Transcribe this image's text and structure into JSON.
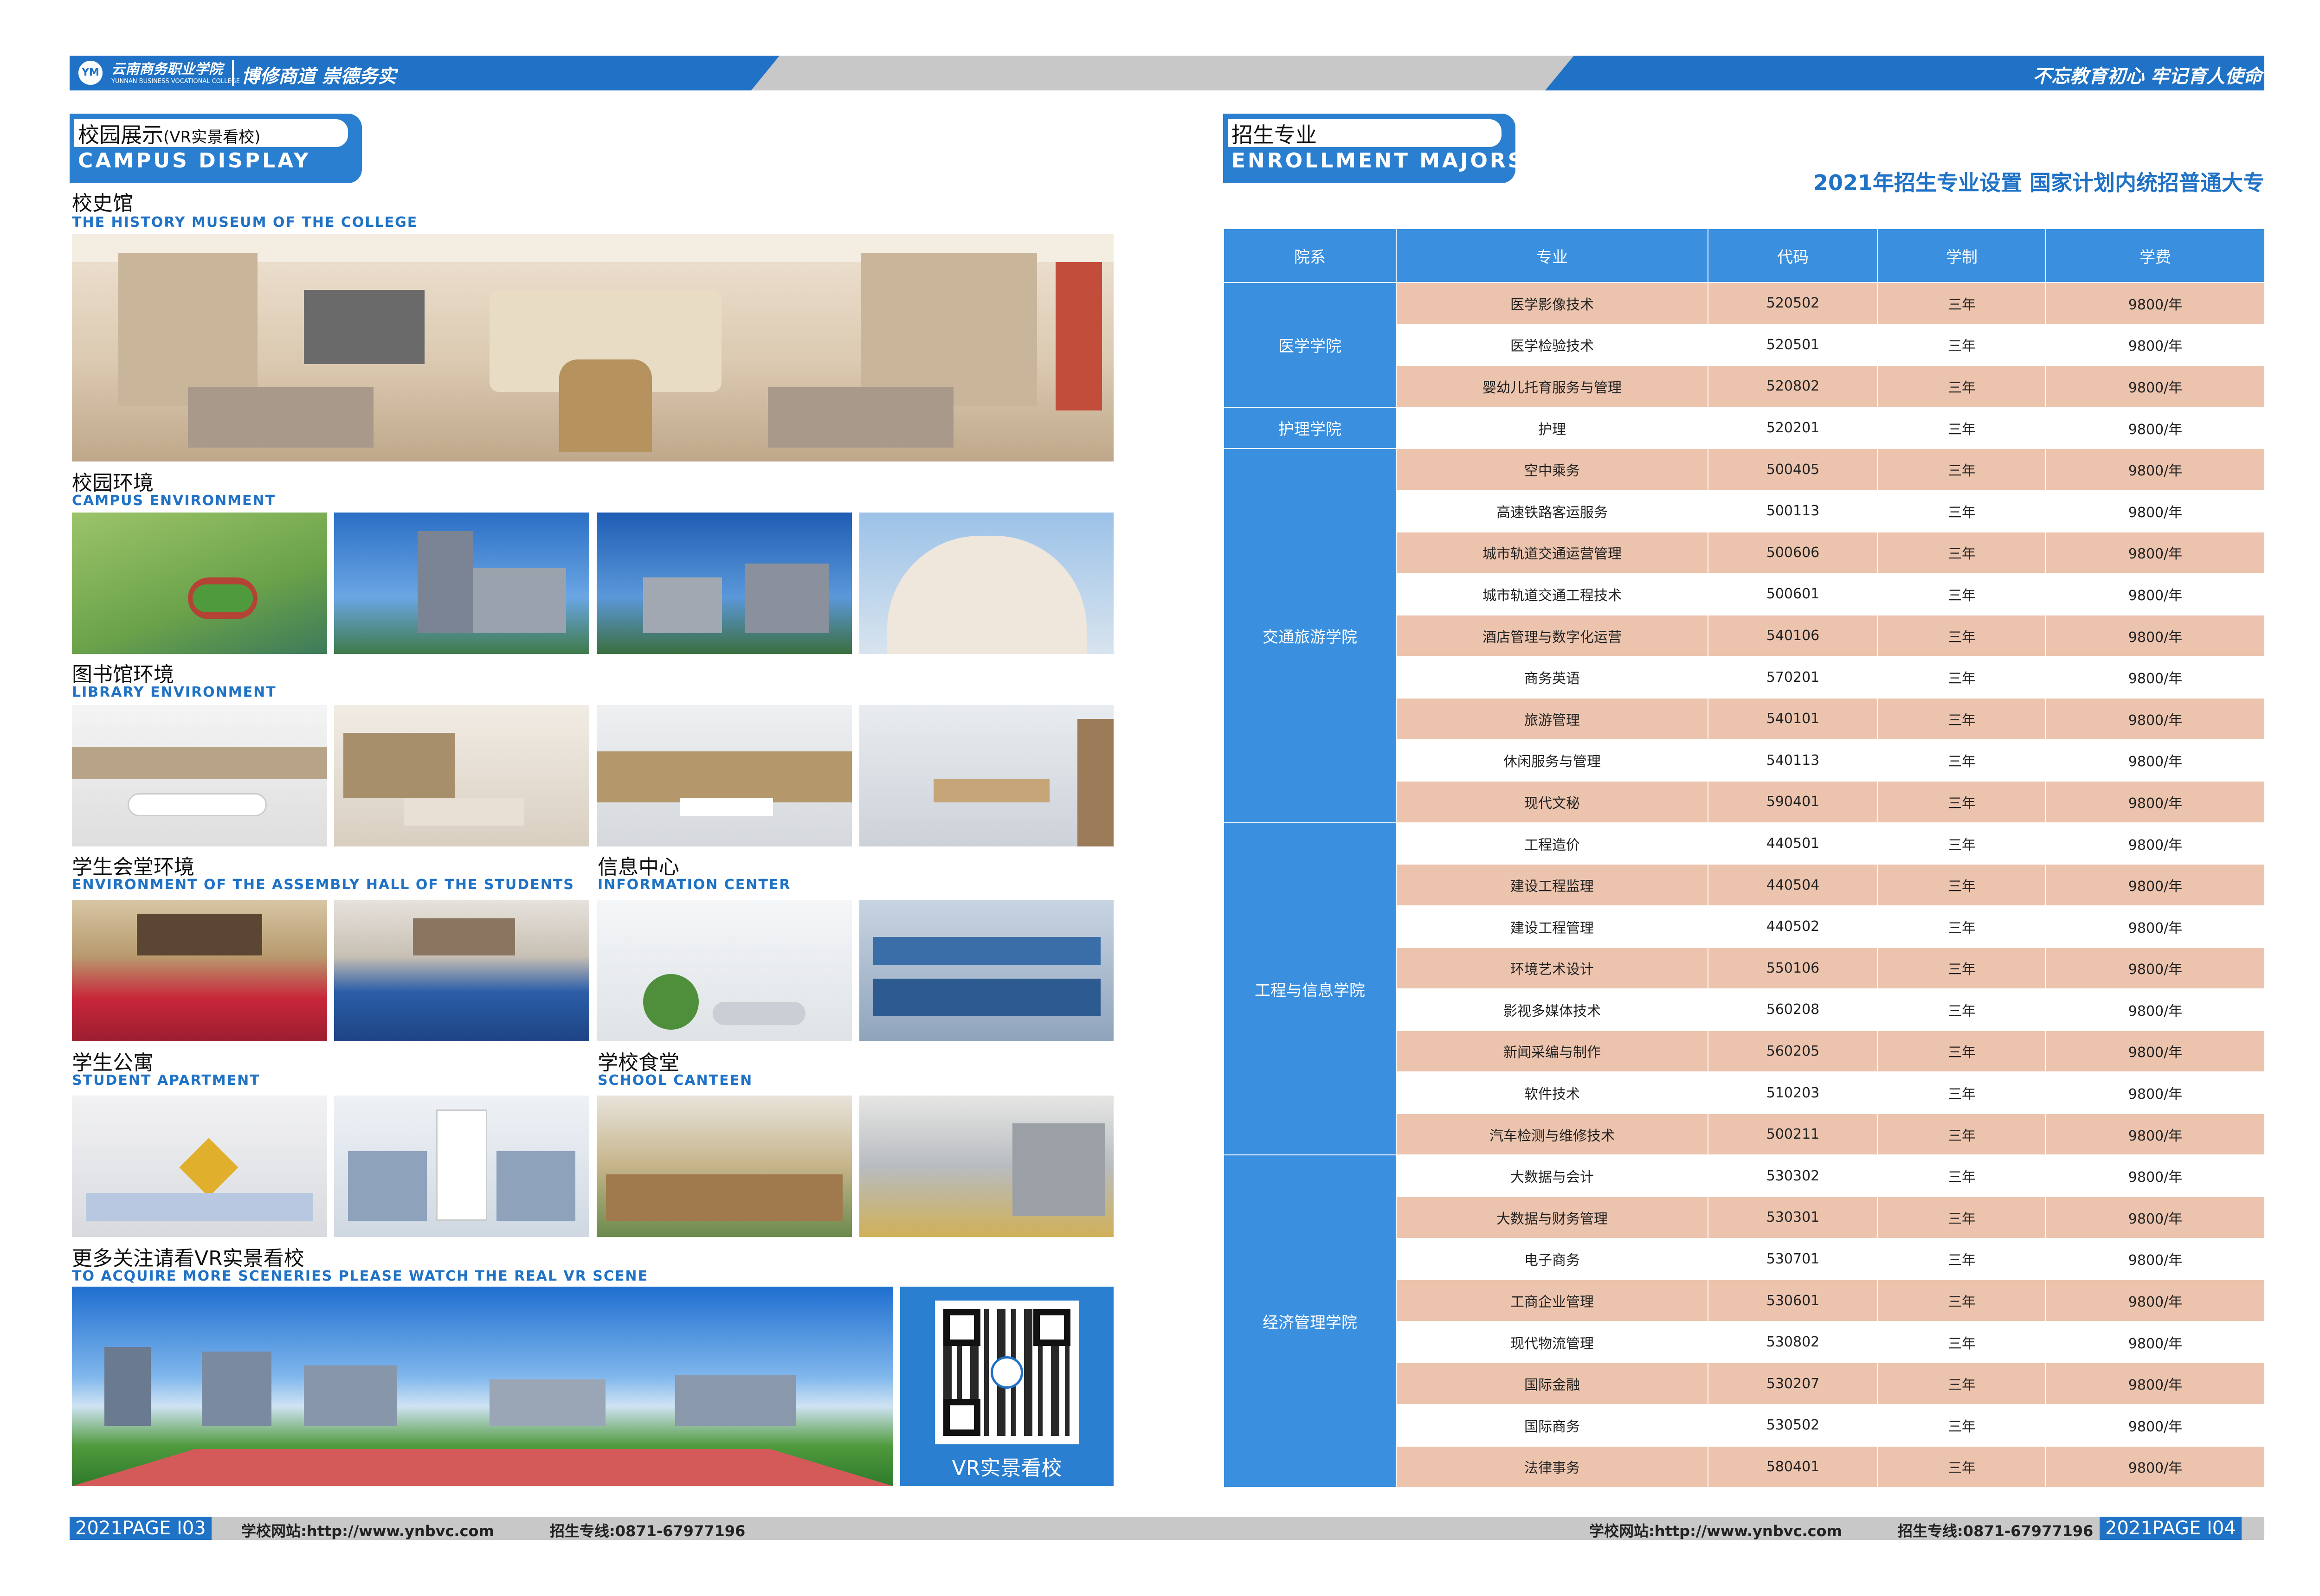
{
  "header": {
    "school_name_cn": "云南商务职业学院",
    "school_name_en": "YUNNAN BUSINESS VOCATIONAL COLLEGE",
    "motto_left": "博修商道  崇德务实",
    "motto_right": "不忘教育初心  牢记育人使命",
    "logo_text": "YM"
  },
  "left_page": {
    "section_title_cn": "校园展示",
    "section_title_cn_sub": "(VR实景看校)",
    "section_title_en": "CAMPUS DISPLAY",
    "museum": {
      "cn": "校史馆",
      "en": "THE HISTORY MUSEUM OF THE COLLEGE"
    },
    "campus": {
      "cn": "校园环境",
      "en": "CAMPUS ENVIRONMENT"
    },
    "library": {
      "cn": "图书馆环境",
      "en": "LIBRARY ENVIRONMENT"
    },
    "assembly": {
      "cn": "学生会堂环境",
      "en": "ENVIRONMENT OF THE ASSEMBLY HALL OF THE STUDENTS"
    },
    "info_center": {
      "cn": "信息中心",
      "en": "INFORMATION CENTER"
    },
    "apartment": {
      "cn": "学生公寓",
      "en": "STUDENT APARTMENT"
    },
    "canteen": {
      "cn": "学校食堂",
      "en": "SCHOOL CANTEEN"
    },
    "vr": {
      "cn": "更多关注请看VR实景看校",
      "en": "TO ACQUIRE MORE SCENERIES PLEASE WATCH THE REAL VR SCENE",
      "qr_caption": "VR实景看校"
    }
  },
  "right_page": {
    "section_title_cn": "招生专业",
    "section_title_en": "ENROLLMENT MAJORS",
    "table_title": "2021年招生专业设置 国家计划内统招普通大专",
    "columns": [
      "院系",
      "专业",
      "代码",
      "学制",
      "学费"
    ],
    "departments": [
      {
        "name": "医学学院",
        "majors": [
          {
            "major": "医学影像技术",
            "code": "520502",
            "years": "三年",
            "fee": "9800/年"
          },
          {
            "major": "医学检验技术",
            "code": "520501",
            "years": "三年",
            "fee": "9800/年"
          },
          {
            "major": "婴幼儿托育服务与管理",
            "code": "520802",
            "years": "三年",
            "fee": "9800/年"
          }
        ]
      },
      {
        "name": "护理学院",
        "majors": [
          {
            "major": "护理",
            "code": "520201",
            "years": "三年",
            "fee": "9800/年"
          }
        ]
      },
      {
        "name": "交通旅游学院",
        "majors": [
          {
            "major": "空中乘务",
            "code": "500405",
            "years": "三年",
            "fee": "9800/年"
          },
          {
            "major": "高速铁路客运服务",
            "code": "500113",
            "years": "三年",
            "fee": "9800/年"
          },
          {
            "major": "城市轨道交通运营管理",
            "code": "500606",
            "years": "三年",
            "fee": "9800/年"
          },
          {
            "major": "城市轨道交通工程技术",
            "code": "500601",
            "years": "三年",
            "fee": "9800/年"
          },
          {
            "major": "酒店管理与数字化运营",
            "code": "540106",
            "years": "三年",
            "fee": "9800/年"
          },
          {
            "major": "商务英语",
            "code": "570201",
            "years": "三年",
            "fee": "9800/年"
          },
          {
            "major": "旅游管理",
            "code": "540101",
            "years": "三年",
            "fee": "9800/年"
          },
          {
            "major": "休闲服务与管理",
            "code": "540113",
            "years": "三年",
            "fee": "9800/年"
          },
          {
            "major": "现代文秘",
            "code": "590401",
            "years": "三年",
            "fee": "9800/年"
          }
        ]
      },
      {
        "name": "工程与信息学院",
        "majors": [
          {
            "major": "工程造价",
            "code": "440501",
            "years": "三年",
            "fee": "9800/年"
          },
          {
            "major": "建设工程监理",
            "code": "440504",
            "years": "三年",
            "fee": "9800/年"
          },
          {
            "major": "建设工程管理",
            "code": "440502",
            "years": "三年",
            "fee": "9800/年"
          },
          {
            "major": "环境艺术设计",
            "code": "550106",
            "years": "三年",
            "fee": "9800/年"
          },
          {
            "major": "影视多媒体技术",
            "code": "560208",
            "years": "三年",
            "fee": "9800/年"
          },
          {
            "major": "新闻采编与制作",
            "code": "560205",
            "years": "三年",
            "fee": "9800/年"
          },
          {
            "major": "软件技术",
            "code": "510203",
            "years": "三年",
            "fee": "9800/年"
          },
          {
            "major": "汽车检测与维修技术",
            "code": "500211",
            "years": "三年",
            "fee": "9800/年"
          }
        ]
      },
      {
        "name": "经济管理学院",
        "majors": [
          {
            "major": "大数据与会计",
            "code": "530302",
            "years": "三年",
            "fee": "9800/年"
          },
          {
            "major": "大数据与财务管理",
            "code": "530301",
            "years": "三年",
            "fee": "9800/年"
          },
          {
            "major": "电子商务",
            "code": "530701",
            "years": "三年",
            "fee": "9800/年"
          },
          {
            "major": "工商企业管理",
            "code": "530601",
            "years": "三年",
            "fee": "9800/年"
          },
          {
            "major": "现代物流管理",
            "code": "530802",
            "years": "三年",
            "fee": "9800/年"
          },
          {
            "major": "国际金融",
            "code": "530207",
            "years": "三年",
            "fee": "9800/年"
          },
          {
            "major": "国际商务",
            "code": "530502",
            "years": "三年",
            "fee": "9800/年"
          },
          {
            "major": "法律事务",
            "code": "580401",
            "years": "三年",
            "fee": "9800/年"
          }
        ]
      }
    ]
  },
  "footer": {
    "left_page_badge": "2021PAGE  I03",
    "right_page_badge": "2021PAGE  I04",
    "website": "学校网站:http://www.ynbvc.com",
    "hotline": "招生专线:0871-67977196"
  },
  "colors": {
    "brand_blue": "#1f72c5",
    "row_highlight": "#ecc4ae",
    "header_blue": "#3a8fde"
  }
}
